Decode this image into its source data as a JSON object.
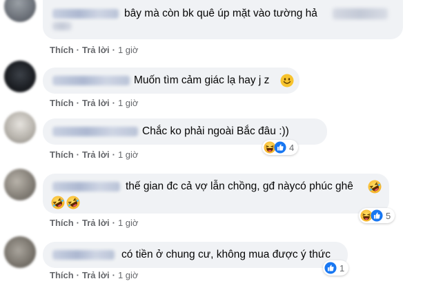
{
  "comments": [
    {
      "text": "bây mà còn bk quê úp mặt vào tường hả",
      "actions": {
        "like": "Thích",
        "reply": "Trả lời",
        "time": "1 giờ"
      }
    },
    {
      "text": "Muốn tìm cảm giác lạ hay j z",
      "actions": {
        "like": "Thích",
        "reply": "Trả lời",
        "time": "1 giờ"
      }
    },
    {
      "text": "Chắc ko phải ngoài Bắc đâu :))",
      "reaction_count": "4",
      "actions": {
        "like": "Thích",
        "reply": "Trả lời",
        "time": "1 giờ"
      }
    },
    {
      "text": "thế gian đc cả vợ lẫn chồng, gđ nàycó phúc ghê",
      "reaction_count": "5",
      "actions": {
        "like": "Thích",
        "reply": "Trả lời",
        "time": "1 giờ"
      }
    },
    {
      "text": "có tiền ở chung cư, không mua được ý thức",
      "reaction_count": "1",
      "actions": {
        "like": "Thích",
        "reply": "Trả lời",
        "time": "1 giờ"
      }
    }
  ],
  "colors": {
    "bubble": "#f0f2f5",
    "meta": "#65676b",
    "like_blue": "#1877f2",
    "haha_yellow": "#f7b125"
  }
}
